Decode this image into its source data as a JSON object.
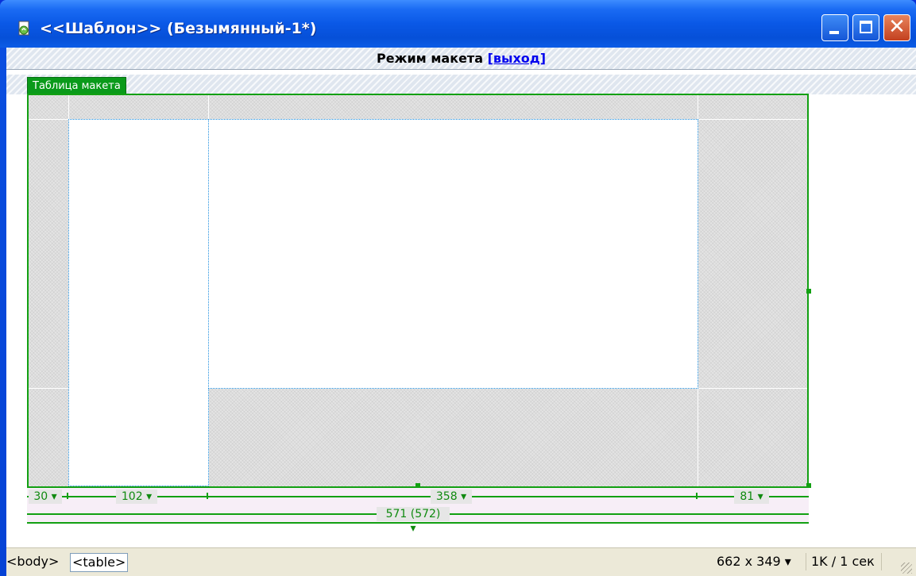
{
  "window": {
    "title": "<<Шаблон>>  (Безымянный-1*)",
    "accent_color": "#0a58e6",
    "close_color": "#d4502a"
  },
  "mode_bar": {
    "label": "Режим макета",
    "exit_link": "[выход]"
  },
  "layout_table": {
    "tab_label": "Таблица макета",
    "border_color": "#12a012",
    "columns": [
      {
        "label": "30 ▾"
      },
      {
        "label": "102 ▾"
      },
      {
        "label": "358 ▾"
      },
      {
        "label": "81 ▾"
      }
    ],
    "total_label": "571 (572) ▾"
  },
  "statusbar": {
    "tag_body": "<body>",
    "tag_table": "<table>",
    "window_size": "662 x 349 ▾",
    "download": "1K / 1 сек"
  }
}
